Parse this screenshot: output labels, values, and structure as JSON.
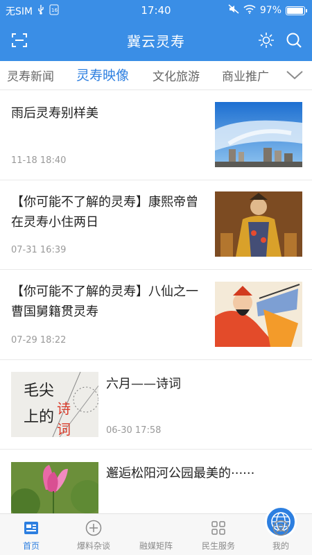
{
  "status_bar": {
    "carrier": "无SIM",
    "time": "17:40",
    "battery": "97%",
    "battery_level": 0.97
  },
  "header": {
    "title": "冀云灵寿"
  },
  "tabs": [
    {
      "label": "灵寿新闻"
    },
    {
      "label": "灵寿映像"
    },
    {
      "label": "文化旅游"
    },
    {
      "label": "商业推广"
    }
  ],
  "news": [
    {
      "title": "雨后灵寿别样美",
      "time": "11-18 18:40"
    },
    {
      "title": "【你可能不了解的灵寿】康熙帝曾在灵寿小住两日",
      "time": "07-31 16:39"
    },
    {
      "title": "【你可能不了解的灵寿】八仙之一曹国舅籍贯灵寿",
      "time": "07-29 18:22"
    },
    {
      "title": "六月——诗词",
      "time": "06-30 17:58"
    },
    {
      "title": "邂逅松阳河公园最美的······",
      "time": ""
    }
  ],
  "thumb4_text": "毛尖上的诗词",
  "bottom_nav": [
    {
      "label": "首页"
    },
    {
      "label": "爆料杂谈"
    },
    {
      "label": "融媒矩阵"
    },
    {
      "label": "民生服务"
    },
    {
      "label": "我的"
    }
  ],
  "colors": {
    "accent": "#3a8ee6",
    "active_tab": "#2d7fe0"
  }
}
